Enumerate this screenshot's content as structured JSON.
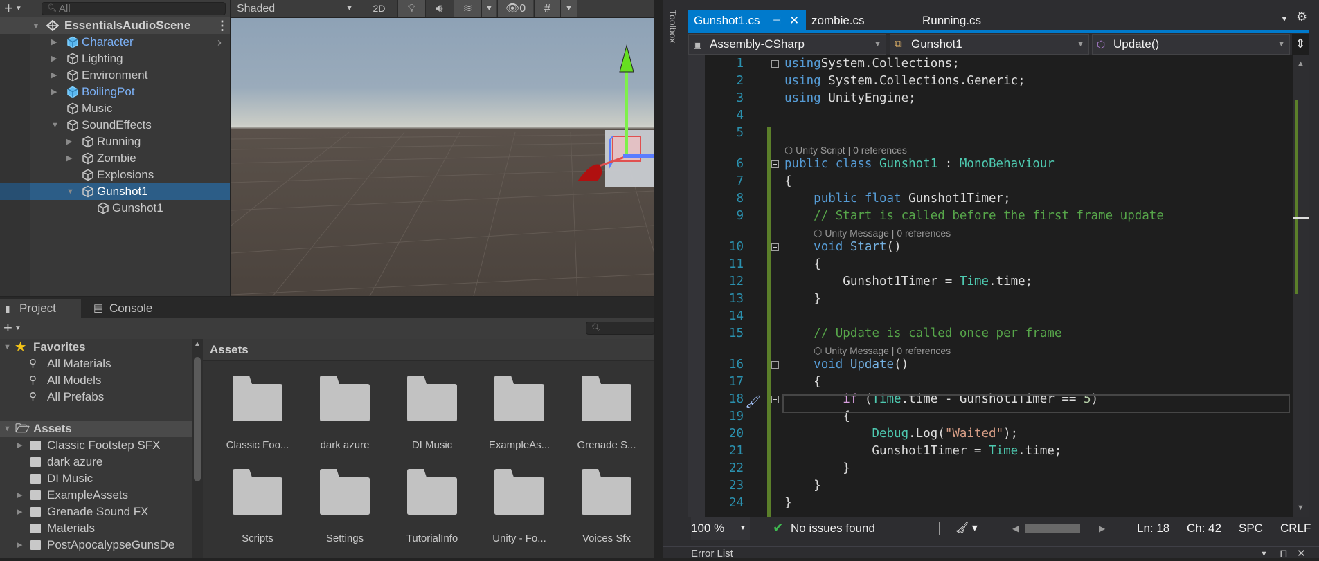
{
  "hierarchy": {
    "search_placeholder": "All",
    "scene_name": "EssentialsAudioScene",
    "items": [
      {
        "label": "Character",
        "depth": 0,
        "arrow": "right",
        "prefab": true,
        "selected": false
      },
      {
        "label": "Lighting",
        "depth": 0,
        "arrow": "right",
        "prefab": false,
        "selected": false
      },
      {
        "label": "Environment",
        "depth": 0,
        "arrow": "right",
        "prefab": false,
        "selected": false
      },
      {
        "label": "BoilingPot",
        "depth": 0,
        "arrow": "right",
        "prefab": true,
        "selected": false
      },
      {
        "label": "Music",
        "depth": 0,
        "arrow": "none",
        "prefab": false,
        "selected": false
      },
      {
        "label": "SoundEffects",
        "depth": 0,
        "arrow": "down",
        "prefab": false,
        "selected": false
      },
      {
        "label": "Running",
        "depth": 1,
        "arrow": "right",
        "prefab": false,
        "selected": false
      },
      {
        "label": "Zombie",
        "depth": 1,
        "arrow": "right",
        "prefab": false,
        "selected": false
      },
      {
        "label": "Explosions",
        "depth": 1,
        "arrow": "none",
        "prefab": false,
        "selected": false
      },
      {
        "label": "Gunshot1",
        "depth": 1,
        "arrow": "down",
        "prefab": false,
        "selected": true
      },
      {
        "label": "Gunshot1",
        "depth": 2,
        "arrow": "none",
        "prefab": false,
        "selected": false
      }
    ]
  },
  "scene_toolbar": {
    "shading_mode": "Shaded",
    "mode_2d": "2D",
    "hidden_count": "0"
  },
  "project": {
    "tabs": [
      "Project",
      "Console"
    ],
    "favorites_label": "Favorites",
    "favorites": [
      "All Materials",
      "All Models",
      "All Prefabs"
    ],
    "assets_label": "Assets",
    "tree": [
      {
        "label": "Classic Footstep SFX",
        "arrow": true
      },
      {
        "label": "dark azure",
        "arrow": false
      },
      {
        "label": "DI Music",
        "arrow": false
      },
      {
        "label": "ExampleAssets",
        "arrow": true
      },
      {
        "label": "Grenade Sound FX",
        "arrow": true
      },
      {
        "label": "Materials",
        "arrow": false
      },
      {
        "label": "PostApocalypseGunsDe",
        "arrow": true
      }
    ],
    "grid_title": "Assets",
    "grid": [
      "Classic Foo...",
      "dark azure",
      "DI Music",
      "ExampleAs...",
      "Grenade S...",
      "Scripts",
      "Settings",
      "TutorialInfo",
      "Unity - Fo...",
      "Voices Sfx"
    ]
  },
  "vs": {
    "toolbox_label": "Toolbox",
    "tabs": [
      "Gunshot1.cs",
      "zombie.cs",
      "Running.cs"
    ],
    "nav": [
      "Assembly-CSharp",
      "Gunshot1",
      "Update()"
    ],
    "lens": {
      "script": "Unity Script | 0 references",
      "message": "Unity Message | 0 references"
    },
    "code": [
      {
        "n": "1",
        "fold": true,
        "t": [
          [
            "kw",
            "using"
          ],
          [
            "",
            "System.Collections;"
          ]
        ]
      },
      {
        "n": "2",
        "t": [
          [
            "kw",
            "using"
          ],
          [
            "",
            " System.Collections.Generic;"
          ]
        ]
      },
      {
        "n": "3",
        "t": [
          [
            "kw",
            "using"
          ],
          [
            "",
            " UnityEngine;"
          ]
        ]
      },
      {
        "n": "4",
        "t": []
      },
      {
        "n": "5",
        "t": []
      },
      {
        "lens": "script",
        "indent": 0
      },
      {
        "n": "6",
        "fold": true,
        "t": [
          [
            "kw",
            "public class "
          ],
          [
            "ty",
            "Gunshot1"
          ],
          [
            "",
            " : "
          ],
          [
            "ty",
            "MonoBehaviour"
          ]
        ]
      },
      {
        "n": "7",
        "t": [
          [
            "",
            "{"
          ]
        ]
      },
      {
        "n": "8",
        "t": [
          [
            "",
            "    "
          ],
          [
            "kw",
            "public float "
          ],
          [
            "",
            "Gunshot1Timer;"
          ]
        ]
      },
      {
        "n": "9",
        "t": [
          [
            "",
            "    "
          ],
          [
            "cm",
            "// Start is called before the first frame update"
          ]
        ]
      },
      {
        "lens": "message",
        "indent": 4
      },
      {
        "n": "10",
        "fold": true,
        "t": [
          [
            "",
            "    "
          ],
          [
            "kw",
            "void "
          ],
          [
            "fn",
            "Start"
          ],
          [
            "",
            "()"
          ]
        ]
      },
      {
        "n": "11",
        "t": [
          [
            "",
            "    {"
          ]
        ]
      },
      {
        "n": "12",
        "t": [
          [
            "",
            "        Gunshot1Timer = "
          ],
          [
            "ty",
            "Time"
          ],
          [
            "",
            ".time;"
          ]
        ]
      },
      {
        "n": "13",
        "t": [
          [
            "",
            "    }"
          ]
        ]
      },
      {
        "n": "14",
        "t": []
      },
      {
        "n": "15",
        "t": [
          [
            "",
            "    "
          ],
          [
            "cm",
            "// Update is called once per frame"
          ]
        ]
      },
      {
        "lens": "message",
        "indent": 4
      },
      {
        "n": "16",
        "fold": true,
        "t": [
          [
            "",
            "    "
          ],
          [
            "kw",
            "void "
          ],
          [
            "fn",
            "Update"
          ],
          [
            "",
            "()"
          ]
        ]
      },
      {
        "n": "17",
        "t": [
          [
            "",
            "    {"
          ]
        ]
      },
      {
        "n": "18",
        "fold": true,
        "t": [
          [
            "",
            "        "
          ],
          [
            "ctl",
            "if"
          ],
          [
            "",
            " ("
          ],
          [
            "ty",
            "Time"
          ],
          [
            "",
            ".time - Gunshot1Timer == "
          ],
          [
            "nm",
            "5"
          ],
          [
            "",
            ")"
          ]
        ]
      },
      {
        "n": "19",
        "t": [
          [
            "",
            "        {"
          ]
        ]
      },
      {
        "n": "20",
        "t": [
          [
            "",
            "            "
          ],
          [
            "ty",
            "Debug"
          ],
          [
            "",
            ".Log("
          ],
          [
            "st",
            "\"Waited\""
          ],
          [
            "",
            ");"
          ]
        ]
      },
      {
        "n": "21",
        "t": [
          [
            "",
            "            Gunshot1Timer = "
          ],
          [
            "ty",
            "Time"
          ],
          [
            "",
            ".time;"
          ]
        ]
      },
      {
        "n": "22",
        "t": [
          [
            "",
            "        }"
          ]
        ]
      },
      {
        "n": "23",
        "t": [
          [
            "",
            "    }"
          ]
        ]
      },
      {
        "n": "24",
        "t": [
          [
            "",
            "}"
          ]
        ]
      }
    ],
    "status": {
      "zoom": "100 %",
      "issues": "No issues found",
      "ln": "Ln: 18",
      "ch": "Ch: 42",
      "spc": "SPC",
      "eol": "CRLF"
    },
    "error_list_label": "Error List"
  },
  "colors": {
    "unity_selection": "#2c5d87",
    "prefab_text": "#7bb0f5",
    "vs_accent": "#007acc",
    "keyword": "#569cd6",
    "type": "#4ec9b0",
    "comment": "#57a64a",
    "string": "#d69d85"
  }
}
